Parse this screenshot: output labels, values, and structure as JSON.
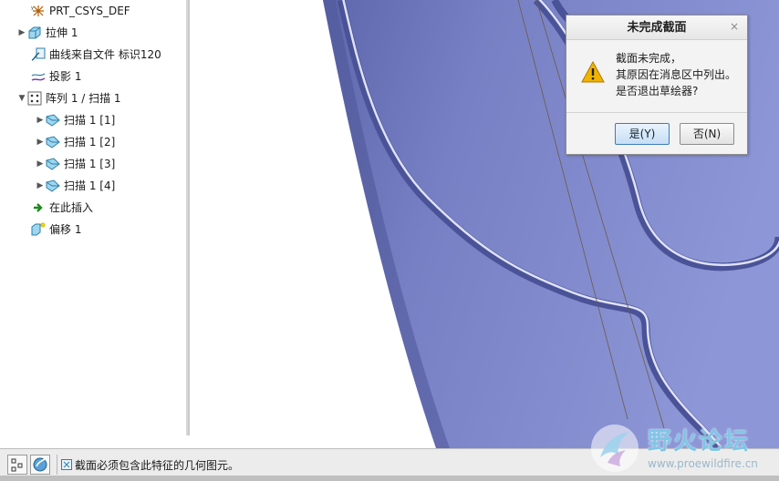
{
  "model_tree": {
    "items": [
      {
        "label": "PRT_CSYS_DEF",
        "icon": "csys-icon",
        "expandable": false
      },
      {
        "label": "拉伸 1",
        "icon": "extrude-icon",
        "expandable": true
      },
      {
        "label": "曲线来自文件 标识120",
        "icon": "curve-from-file-icon",
        "expandable": false
      },
      {
        "label": "投影 1",
        "icon": "projection-icon",
        "expandable": false
      },
      {
        "label": "阵列 1 / 扫描 1",
        "icon": "pattern-icon",
        "expandable": true,
        "expanded": true
      },
      {
        "label": "扫描 1 [1]",
        "icon": "sweep-icon",
        "expandable": true
      },
      {
        "label": "扫描 1 [2]",
        "icon": "sweep-icon",
        "expandable": true
      },
      {
        "label": "扫描 1 [3]",
        "icon": "sweep-icon",
        "expandable": true
      },
      {
        "label": "扫描 1 [4]",
        "icon": "sweep-icon",
        "expandable": true
      },
      {
        "label": "在此插入",
        "icon": "insert-here-arrow-icon",
        "expandable": false
      },
      {
        "label": "偏移 1",
        "icon": "offset-icon",
        "expandable": false
      }
    ]
  },
  "dialog": {
    "title": "未完成截面",
    "close_glyph": "×",
    "message_lines": [
      "截面未完成，",
      "其原因在消息区中列出。",
      "是否退出草绘器?"
    ],
    "yes_label": "是(Y)",
    "no_label": "否(N)"
  },
  "status_bar": {
    "message": "截面必须包含此特征的几何图元。"
  },
  "watermark": {
    "title": "野火论坛",
    "url": "www.proewildfire.cn"
  },
  "colors": {
    "model_surface": "#7c86c8",
    "model_shadow": "#5a63a8",
    "highlight": "#d8dcf5",
    "dialog_button_accent": "#3d7bbf",
    "warning": "#f0b400"
  }
}
